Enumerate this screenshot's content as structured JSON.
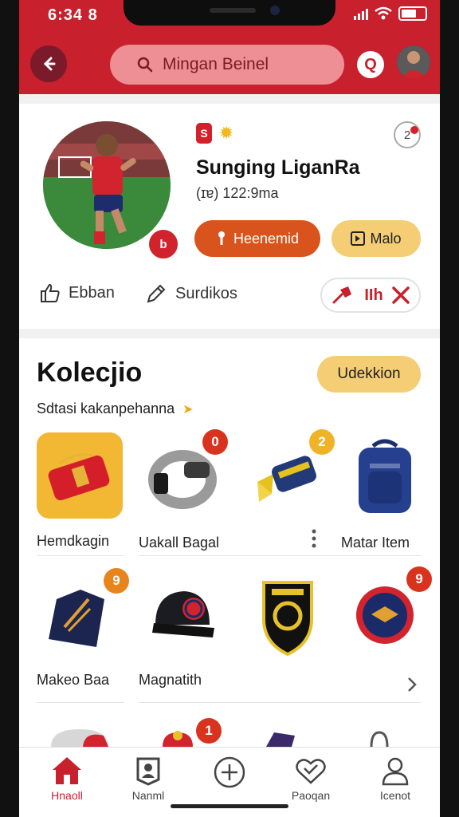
{
  "status_bar": {
    "time": "6:34 8"
  },
  "header": {
    "search_text": "Mingan Beinel",
    "q_label": "Q"
  },
  "profile": {
    "badge_letter": "S",
    "notification_count": "2",
    "name": "Sunging LiganRa",
    "meta": "(ɪɐ) 122:9ma",
    "avatar_badge": "b",
    "primary_button": "Heenemid",
    "secondary_button": "Malo",
    "action_1": "Ebban",
    "action_2": "Surdikos",
    "rival_label": "IIh"
  },
  "collection": {
    "title": "Kolecjio",
    "button": "Udekkion",
    "subtitle": "Sdtasi kakanpehanna",
    "items": [
      {
        "label": "Hemdkagin",
        "badge": ""
      },
      {
        "label": "Uakall Bagal",
        "badge": "0"
      },
      {
        "label": "",
        "badge": "2"
      },
      {
        "label": "Matar Item",
        "badge": ""
      },
      {
        "label": "Makeo Baa",
        "badge": "9"
      },
      {
        "label": "Magnatith",
        "badge": ""
      },
      {
        "label": "",
        "badge": ""
      },
      {
        "label": "",
        "badge": "9"
      },
      {
        "label": "",
        "badge": ""
      },
      {
        "label": "",
        "badge": "1"
      },
      {
        "label": "",
        "badge": ""
      },
      {
        "label": "",
        "badge": ""
      }
    ]
  },
  "bottom_nav": [
    {
      "label": "Hnaoll",
      "active": true
    },
    {
      "label": "Nanml",
      "active": false
    },
    {
      "label": "",
      "active": false
    },
    {
      "label": "Paoqan",
      "active": false
    },
    {
      "label": "Icenot",
      "active": false
    }
  ],
  "colors": {
    "brand_red": "#c8202c",
    "accent_orange": "#d9541c",
    "accent_yellow": "#f4cd74"
  }
}
